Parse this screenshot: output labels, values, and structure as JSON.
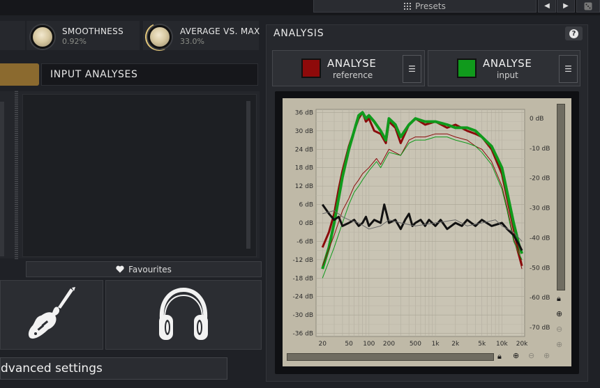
{
  "topbar": {
    "presets_label": "Presets",
    "prev_glyph": "◀",
    "next_glyph": "▶"
  },
  "knobs": [
    {
      "label": "SMOOTHNESS",
      "value": "0.92%"
    },
    {
      "label": "AVERAGE VS. MAX",
      "value": "33.0%"
    }
  ],
  "input_analyses": {
    "title": "INPUT ANALYSES"
  },
  "favourites": {
    "label": "Favourites"
  },
  "tiles": [
    {
      "icon": "electric-guitar-icon"
    },
    {
      "icon": "headphones-icon"
    }
  ],
  "advanced": {
    "label": "dvanced settings"
  },
  "analysis": {
    "title": "ANALYSIS",
    "help_glyph": "?",
    "buttons": [
      {
        "title": "ANALYSE",
        "sub": "reference",
        "color": "#8e0a0a",
        "menu_glyph": "☰"
      },
      {
        "title": "ANALYSE",
        "sub": "input",
        "color": "#109a1c",
        "menu_glyph": "☰"
      }
    ]
  },
  "chart_data": {
    "type": "line",
    "x_scale": "log",
    "xlim": [
      16,
      22000
    ],
    "ylim": [
      -37,
      37
    ],
    "ylim_right": [
      -73,
      3
    ],
    "x_ticks": [
      "20",
      "50",
      "100",
      "200",
      "500",
      "1k",
      "2k",
      "5k",
      "10k",
      "20k"
    ],
    "x_tick_values": [
      20,
      50,
      100,
      200,
      500,
      1000,
      2000,
      5000,
      10000,
      20000
    ],
    "y_ticks_left": [
      "36 dB",
      "30 dB",
      "24 dB",
      "18 dB",
      "12 dB",
      "6 dB",
      "0 dB",
      "-6 dB",
      "-12 dB",
      "-18 dB",
      "-24 dB",
      "-30 dB",
      "-36 dB"
    ],
    "y_tick_values_left": [
      36,
      30,
      24,
      18,
      12,
      6,
      0,
      -6,
      -12,
      -18,
      -24,
      -30,
      -36
    ],
    "y_ticks_right": [
      "0 dB",
      "-10 dB",
      "-20 dB",
      "-30 dB",
      "-40 dB",
      "-50 dB",
      "-60 dB",
      "-70 dB"
    ],
    "y_tick_values_right": [
      0,
      -10,
      -20,
      -30,
      -40,
      -50,
      -60,
      -70
    ],
    "grid": true,
    "series": [
      {
        "color": "#8a0b0b",
        "width": 3,
        "points": [
          [
            20,
            -8
          ],
          [
            25,
            -3
          ],
          [
            30,
            3
          ],
          [
            35,
            11
          ],
          [
            40,
            17
          ],
          [
            50,
            25
          ],
          [
            60,
            30
          ],
          [
            70,
            34
          ],
          [
            80,
            36
          ],
          [
            90,
            33
          ],
          [
            100,
            34
          ],
          [
            120,
            30
          ],
          [
            150,
            29
          ],
          [
            180,
            26
          ],
          [
            200,
            33
          ],
          [
            250,
            31
          ],
          [
            300,
            26
          ],
          [
            400,
            32
          ],
          [
            500,
            34
          ],
          [
            700,
            32
          ],
          [
            1000,
            33
          ],
          [
            1500,
            31
          ],
          [
            2000,
            32
          ],
          [
            3000,
            30
          ],
          [
            4000,
            29
          ],
          [
            5000,
            28
          ],
          [
            7000,
            24
          ],
          [
            10000,
            16
          ],
          [
            12000,
            8
          ],
          [
            15000,
            -2
          ],
          [
            18000,
            -10
          ],
          [
            20000,
            -14
          ]
        ]
      },
      {
        "color": "#109a1c",
        "width": 4,
        "points": [
          [
            20,
            -15
          ],
          [
            25,
            -8
          ],
          [
            30,
            0
          ],
          [
            35,
            8
          ],
          [
            40,
            15
          ],
          [
            50,
            24
          ],
          [
            60,
            30
          ],
          [
            70,
            35
          ],
          [
            80,
            36
          ],
          [
            90,
            34
          ],
          [
            100,
            35
          ],
          [
            120,
            33
          ],
          [
            150,
            30
          ],
          [
            180,
            27
          ],
          [
            200,
            34
          ],
          [
            250,
            32
          ],
          [
            300,
            28
          ],
          [
            400,
            32
          ],
          [
            500,
            34
          ],
          [
            700,
            33
          ],
          [
            1000,
            33
          ],
          [
            1500,
            32
          ],
          [
            2000,
            31
          ],
          [
            3000,
            31
          ],
          [
            4000,
            30
          ],
          [
            5000,
            28
          ],
          [
            7000,
            25
          ],
          [
            10000,
            18
          ],
          [
            12000,
            10
          ],
          [
            15000,
            0
          ],
          [
            18000,
            -7
          ],
          [
            20000,
            -10
          ]
        ]
      },
      {
        "color": "#8a0b0b",
        "width": 1,
        "points": [
          [
            20,
            -14
          ],
          [
            30,
            -4
          ],
          [
            40,
            4
          ],
          [
            50,
            8
          ],
          [
            60,
            12
          ],
          [
            70,
            14
          ],
          [
            80,
            16
          ],
          [
            100,
            18
          ],
          [
            130,
            21
          ],
          [
            150,
            19
          ],
          [
            200,
            24
          ],
          [
            300,
            22
          ],
          [
            400,
            27
          ],
          [
            500,
            28
          ],
          [
            700,
            28
          ],
          [
            1000,
            29
          ],
          [
            1500,
            29
          ],
          [
            2000,
            28
          ],
          [
            3000,
            27
          ],
          [
            4000,
            25
          ],
          [
            5000,
            24
          ],
          [
            7000,
            20
          ],
          [
            10000,
            12
          ],
          [
            12000,
            5
          ],
          [
            15000,
            -5
          ],
          [
            20000,
            -15
          ]
        ]
      },
      {
        "color": "#109a1c",
        "width": 1,
        "points": [
          [
            20,
            -18
          ],
          [
            30,
            -8
          ],
          [
            40,
            0
          ],
          [
            50,
            6
          ],
          [
            60,
            10
          ],
          [
            70,
            12
          ],
          [
            80,
            14
          ],
          [
            100,
            17
          ],
          [
            130,
            20
          ],
          [
            150,
            18
          ],
          [
            200,
            23
          ],
          [
            300,
            22
          ],
          [
            400,
            26
          ],
          [
            500,
            27
          ],
          [
            700,
            27
          ],
          [
            1000,
            28
          ],
          [
            1500,
            28
          ],
          [
            2000,
            27
          ],
          [
            3000,
            26
          ],
          [
            4000,
            25
          ],
          [
            5000,
            23
          ],
          [
            7000,
            19
          ],
          [
            10000,
            11
          ],
          [
            12000,
            4
          ],
          [
            15000,
            -6
          ],
          [
            20000,
            -12
          ]
        ]
      },
      {
        "color": "#111111",
        "width": 3,
        "points": [
          [
            20,
            6
          ],
          [
            25,
            3
          ],
          [
            30,
            1
          ],
          [
            35,
            2
          ],
          [
            40,
            -1
          ],
          [
            50,
            0
          ],
          [
            60,
            1
          ],
          [
            70,
            -1
          ],
          [
            80,
            0
          ],
          [
            90,
            2
          ],
          [
            100,
            -1
          ],
          [
            120,
            1
          ],
          [
            150,
            0
          ],
          [
            170,
            6
          ],
          [
            200,
            0
          ],
          [
            250,
            1
          ],
          [
            300,
            -2
          ],
          [
            350,
            1
          ],
          [
            400,
            3
          ],
          [
            450,
            -1
          ],
          [
            500,
            0
          ],
          [
            600,
            1
          ],
          [
            700,
            -1
          ],
          [
            800,
            1
          ],
          [
            1000,
            -1
          ],
          [
            1200,
            1
          ],
          [
            1500,
            -2
          ],
          [
            2000,
            0
          ],
          [
            2500,
            -1
          ],
          [
            3000,
            1
          ],
          [
            4000,
            -1
          ],
          [
            5000,
            1
          ],
          [
            7000,
            -1
          ],
          [
            10000,
            0
          ],
          [
            12000,
            -2
          ],
          [
            15000,
            -4
          ],
          [
            18000,
            -7
          ],
          [
            20000,
            -9
          ]
        ]
      },
      {
        "color": "#666666",
        "width": 1,
        "points": [
          [
            20,
            3
          ],
          [
            30,
            4
          ],
          [
            40,
            2
          ],
          [
            50,
            1
          ],
          [
            70,
            0
          ],
          [
            100,
            -2
          ],
          [
            150,
            -1
          ],
          [
            200,
            1
          ],
          [
            300,
            0
          ],
          [
            500,
            -1
          ],
          [
            1000,
            0
          ],
          [
            2000,
            1
          ],
          [
            3000,
            -1
          ],
          [
            5000,
            0
          ],
          [
            8000,
            1
          ],
          [
            10000,
            -1
          ],
          [
            15000,
            -3
          ],
          [
            20000,
            -6
          ]
        ]
      }
    ]
  }
}
